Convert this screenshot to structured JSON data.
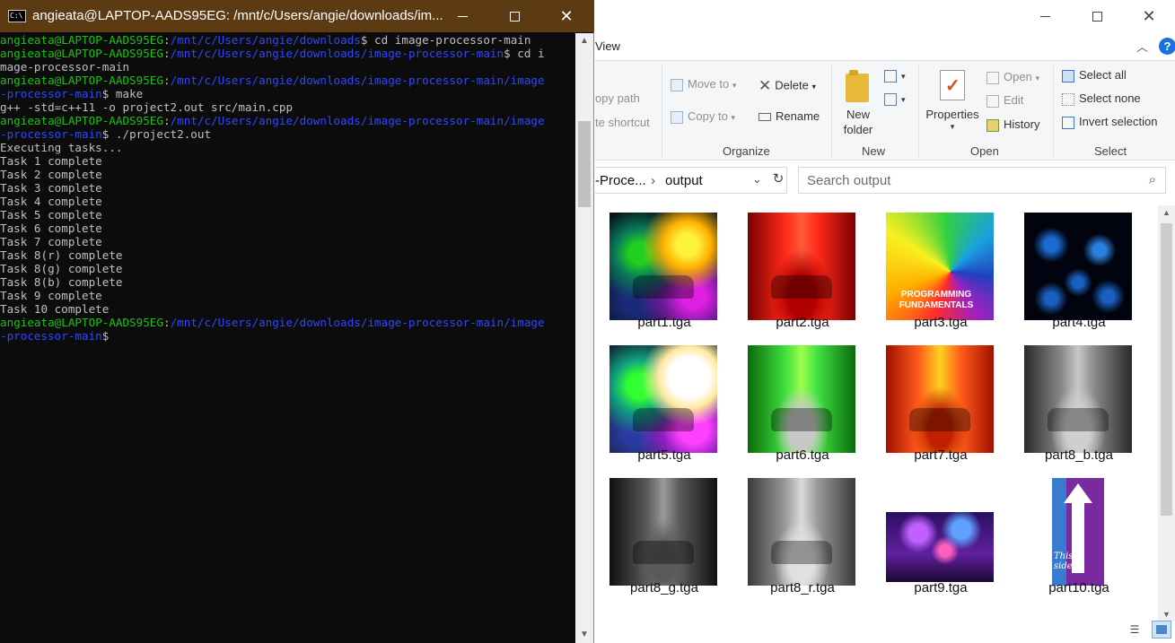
{
  "terminal": {
    "title": "angieata@LAPTOP-AADS95EG: /mnt/c/Users/angie/downloads/im...",
    "icon": "C:\\",
    "lines": [
      [
        {
          "t": "angieata@LAPTOP-AADS95EG",
          "c": "user"
        },
        {
          "t": ":",
          "c": "w"
        },
        {
          "t": "/mnt/c/Users/angie/downloads",
          "c": "path"
        },
        {
          "t": "$ cd image-processor-main",
          "c": "w"
        }
      ],
      [
        {
          "t": "angieata@LAPTOP-AADS95EG",
          "c": "user"
        },
        {
          "t": ":",
          "c": "w"
        },
        {
          "t": "/mnt/c/Users/angie/downloads/image-processor-main",
          "c": "path"
        },
        {
          "t": "$ cd i",
          "c": "w"
        }
      ],
      [
        {
          "t": "mage-processor-main",
          "c": "w"
        }
      ],
      [
        {
          "t": "angieata@LAPTOP-AADS95EG",
          "c": "user"
        },
        {
          "t": ":",
          "c": "w"
        },
        {
          "t": "/mnt/c/Users/angie/downloads/image-processor-main/image",
          "c": "path"
        }
      ],
      [
        {
          "t": "-processor-main",
          "c": "path"
        },
        {
          "t": "$ make",
          "c": "w"
        }
      ],
      [
        {
          "t": "g++ -std=c++11 -o project2.out src/main.cpp",
          "c": "w"
        }
      ],
      [
        {
          "t": "angieata@LAPTOP-AADS95EG",
          "c": "user"
        },
        {
          "t": ":",
          "c": "w"
        },
        {
          "t": "/mnt/c/Users/angie/downloads/image-processor-main/image",
          "c": "path"
        }
      ],
      [
        {
          "t": "-processor-main",
          "c": "path"
        },
        {
          "t": "$ ./project2.out",
          "c": "w"
        }
      ],
      [
        {
          "t": "Executing tasks...",
          "c": "w"
        }
      ],
      [
        {
          "t": "Task 1 complete",
          "c": "w"
        }
      ],
      [
        {
          "t": "Task 2 complete",
          "c": "w"
        }
      ],
      [
        {
          "t": "Task 3 complete",
          "c": "w"
        }
      ],
      [
        {
          "t": "Task 4 complete",
          "c": "w"
        }
      ],
      [
        {
          "t": "Task 5 complete",
          "c": "w"
        }
      ],
      [
        {
          "t": "Task 6 complete",
          "c": "w"
        }
      ],
      [
        {
          "t": "Task 7 complete",
          "c": "w"
        }
      ],
      [
        {
          "t": "Task 8(r) complete",
          "c": "w"
        }
      ],
      [
        {
          "t": "Task 8(g) complete",
          "c": "w"
        }
      ],
      [
        {
          "t": "Task 8(b) complete",
          "c": "w"
        }
      ],
      [
        {
          "t": "Task 9 complete",
          "c": "w"
        }
      ],
      [
        {
          "t": "Task 10 complete",
          "c": "w"
        }
      ],
      [
        {
          "t": "angieata@LAPTOP-AADS95EG",
          "c": "user"
        },
        {
          "t": ":",
          "c": "w"
        },
        {
          "t": "/mnt/c/Users/angie/downloads/image-processor-main/image",
          "c": "path"
        }
      ],
      [
        {
          "t": "-processor-main",
          "c": "path"
        },
        {
          "t": "$",
          "c": "w"
        }
      ]
    ],
    "colors": {
      "user": "#16c60c",
      "path": "#2e48ff",
      "text": "#c0c0c0",
      "background": "#0c0c0c",
      "titlebar": "#5c3b12"
    }
  },
  "explorer": {
    "menu": {
      "view_tab": "View"
    },
    "ribbon": {
      "clipboard_partial": {
        "copy_path": "opy path",
        "paste_shortcut": "te shortcut"
      },
      "organize": {
        "label": "Organize",
        "move_to": "Move to",
        "copy_to": "Copy to",
        "delete": "Delete",
        "rename": "Rename"
      },
      "new": {
        "label": "New",
        "new_folder_line1": "New",
        "new_folder_line2": "folder"
      },
      "open": {
        "label": "Open",
        "properties": "Properties",
        "open": "Open",
        "edit": "Edit",
        "history": "History"
      },
      "select": {
        "label": "Select",
        "select_all": "Select all",
        "select_none": "Select none",
        "invert_selection": "Invert selection"
      }
    },
    "address": {
      "parent": "-Proce...",
      "current": "output"
    },
    "search": {
      "placeholder": "Search output"
    },
    "files": [
      {
        "name": "part1.tga",
        "thumb": "swirl"
      },
      {
        "name": "part2.tga",
        "thumb": "car-red"
      },
      {
        "name": "part3.tga",
        "thumb": "rainbow",
        "overlay_text": "PROGRAMMING FUNDAMENTALS"
      },
      {
        "name": "part4.tga",
        "thumb": "blue-dark"
      },
      {
        "name": "part5.tga",
        "thumb": "swirl-bright"
      },
      {
        "name": "part6.tga",
        "thumb": "car-green"
      },
      {
        "name": "part7.tga",
        "thumb": "car-orange"
      },
      {
        "name": "part8_b.tga",
        "thumb": "car-gray"
      },
      {
        "name": "part8_g.tga",
        "thumb": "car-gray-dark"
      },
      {
        "name": "part8_r.tga",
        "thumb": "car-gray-light"
      },
      {
        "name": "part9.tga",
        "thumb": "night"
      },
      {
        "name": "part10.tga",
        "thumb": "arrow",
        "overlay_text": "This side"
      }
    ]
  }
}
